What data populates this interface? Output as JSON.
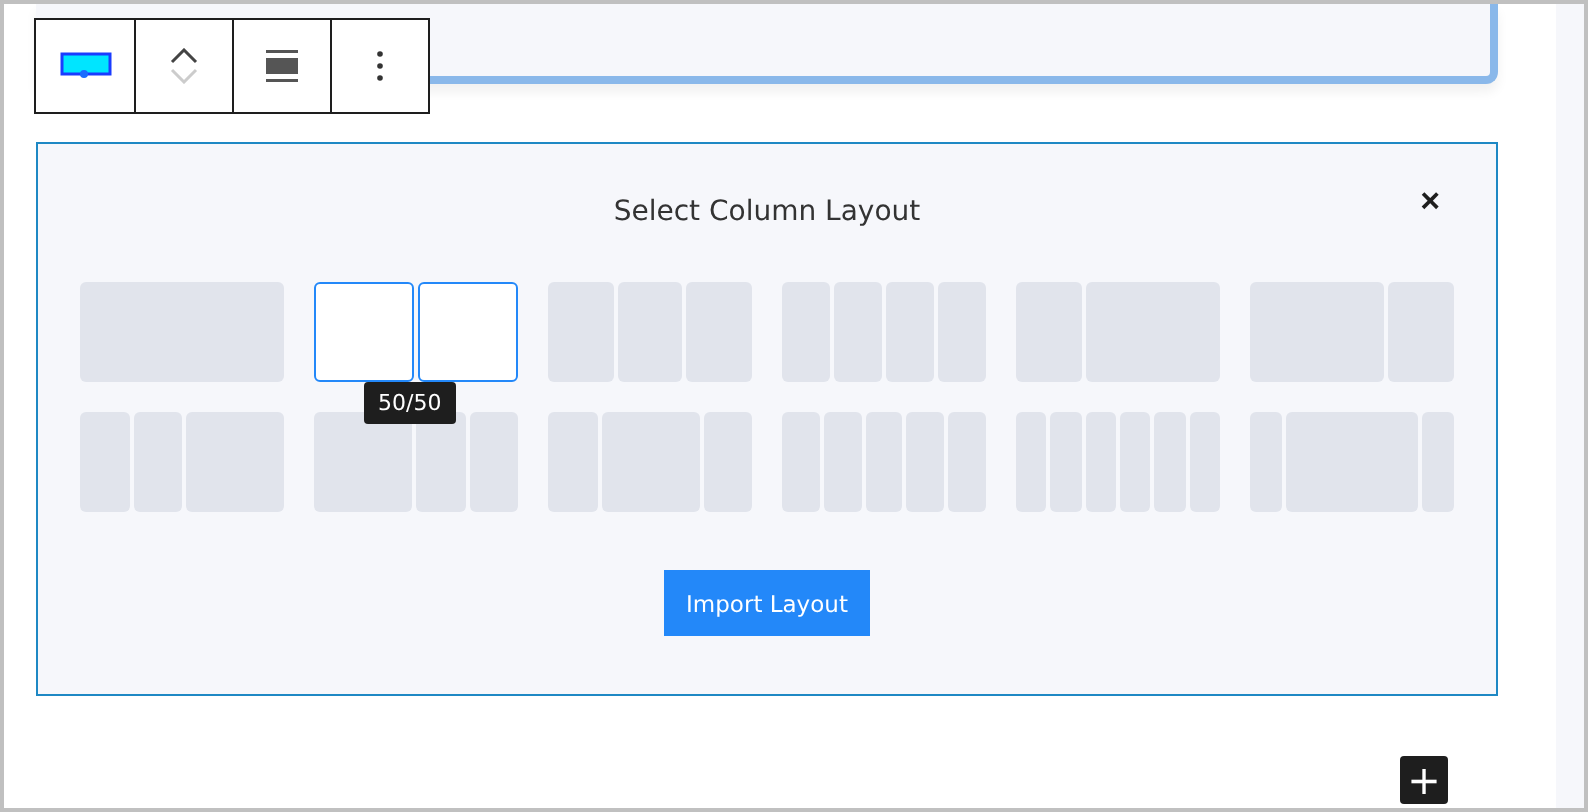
{
  "toolbar": {
    "buttons": [
      {
        "kind": "block"
      },
      {
        "kind": "move",
        "down_disabled": true
      },
      {
        "kind": "align"
      },
      {
        "kind": "more"
      }
    ]
  },
  "panel": {
    "title": "Select Column Layout",
    "close": "×",
    "button": "Import Layout",
    "layouts": [
      {
        "kind": "full",
        "selected": false
      },
      {
        "kind": "halves",
        "selected": true,
        "tooltip": "50/50"
      },
      {
        "kind": "thirds",
        "selected": false
      },
      {
        "kind": "quarters",
        "selected": false
      },
      {
        "kind": "one-two",
        "selected": false
      },
      {
        "kind": "two-one",
        "selected": false
      },
      {
        "kind": "quarter-quarter-half",
        "selected": false
      },
      {
        "kind": "half-quarter-quarter",
        "selected": false
      },
      {
        "kind": "quarter-half-quarter",
        "selected": false
      },
      {
        "kind": "fifths",
        "selected": false
      },
      {
        "kind": "sixths",
        "selected": false
      },
      {
        "kind": "sixth-wide-sixth",
        "selected": false
      }
    ]
  },
  "add_button": "+"
}
